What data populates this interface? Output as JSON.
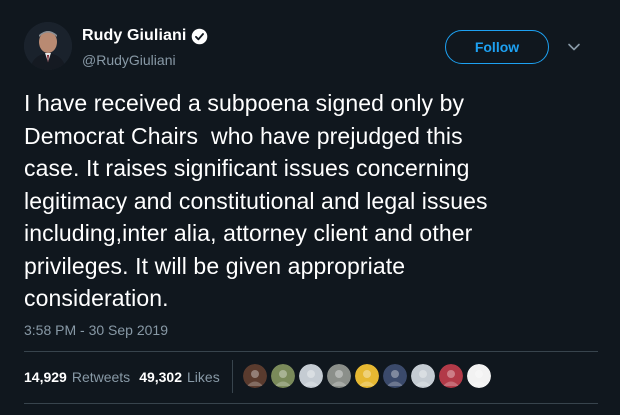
{
  "author": {
    "display_name": "Rudy Giuliani",
    "handle": "@RudyGiuliani",
    "verified": true
  },
  "actions": {
    "follow_label": "Follow"
  },
  "tweet": {
    "text": "I have received a subpoena signed only by\nDemocrat Chairs  who have prejudged this\ncase. It raises significant issues concerning\nlegitimacy and constitutional and legal issues\nincluding,inter alia, attorney client and other\nprivileges. It will be given appropriate\nconsideration.",
    "timestamp": "3:58 PM - 30 Sep 2019"
  },
  "stats": {
    "retweets_count": "14,929",
    "retweets_label": "Retweets",
    "likes_count": "49,302",
    "likes_label": "Likes"
  },
  "likers": [
    {
      "name": "liker-avatar-1",
      "color": "#5a3b2e"
    },
    {
      "name": "liker-avatar-2",
      "color": "#7a8a5a"
    },
    {
      "name": "liker-avatar-3",
      "color": "#c5ccd3"
    },
    {
      "name": "liker-avatar-4",
      "color": "#8b8f8a"
    },
    {
      "name": "liker-avatar-5",
      "color": "#e6b832"
    },
    {
      "name": "liker-avatar-6",
      "color": "#3b4a6b"
    },
    {
      "name": "liker-avatar-7",
      "color": "#c5ccd3"
    },
    {
      "name": "liker-avatar-8",
      "color": "#b23a48"
    },
    {
      "name": "liker-avatar-9",
      "color": "#f2f2f2"
    }
  ],
  "colors": {
    "background": "#10171e",
    "accent": "#1da1f2",
    "muted_text": "#8899a6",
    "divider": "#38444d"
  }
}
